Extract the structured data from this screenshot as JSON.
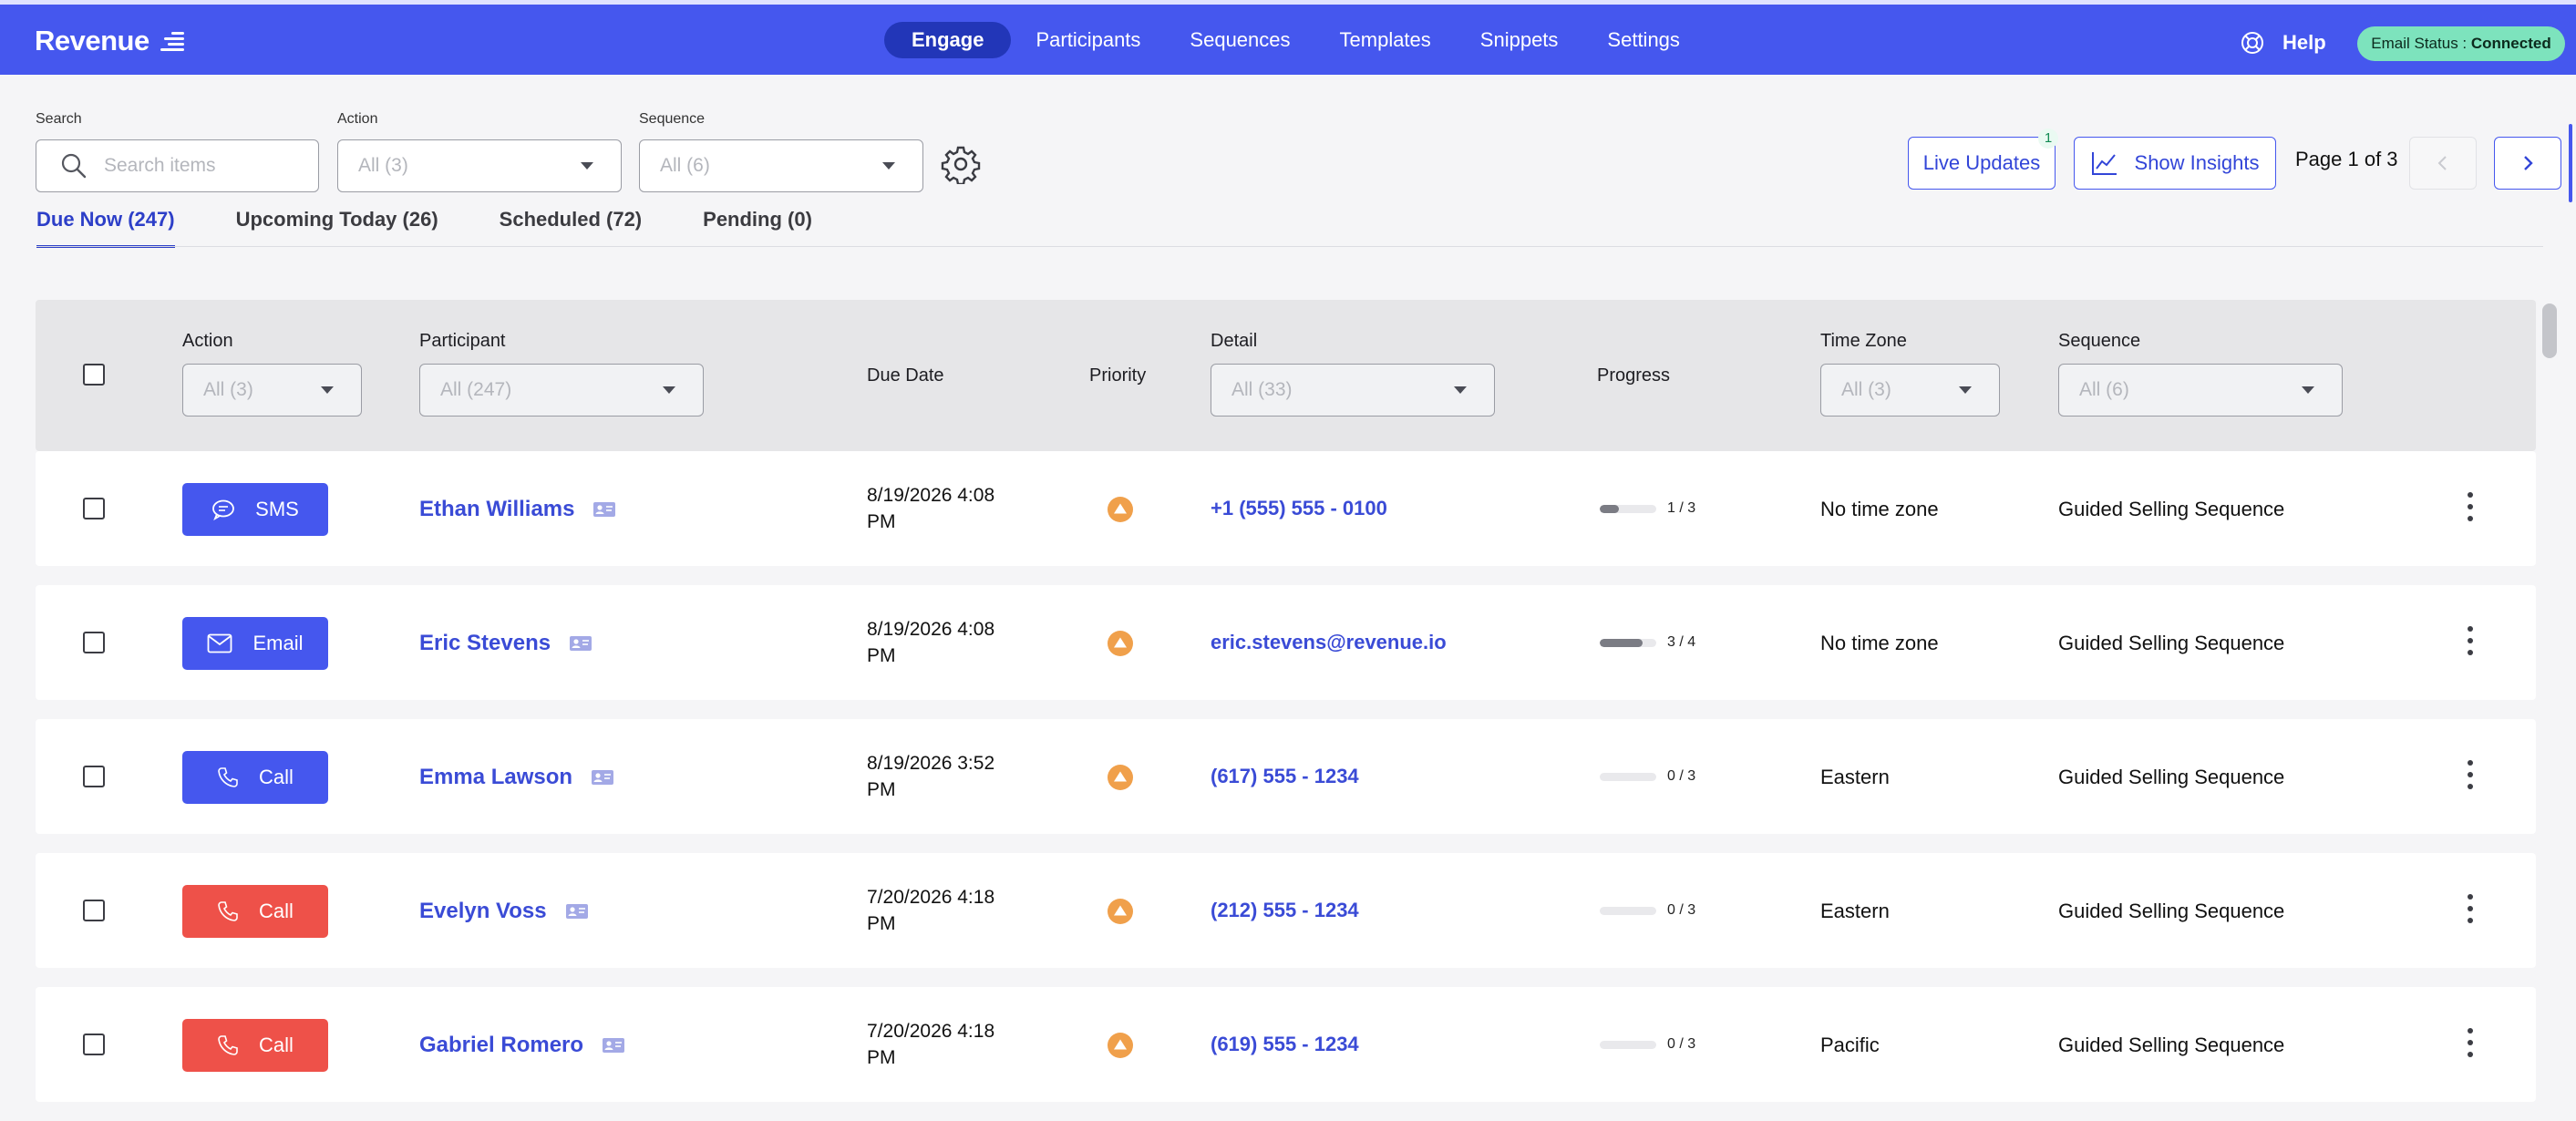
{
  "app": {
    "brand": "Revenue"
  },
  "nav": {
    "items": [
      "Engage",
      "Participants",
      "Sequences",
      "Templates",
      "Snippets",
      "Settings"
    ],
    "active": "Engage",
    "help": "Help",
    "email_status_label": "Email Status : ",
    "email_status_value": "Connected"
  },
  "filters": {
    "search_label": "Search",
    "search_placeholder": "Search items",
    "action_label": "Action",
    "action_value": "All (3)",
    "sequence_label": "Sequence",
    "sequence_value": "All (6)"
  },
  "toolbar": {
    "live_updates": "Live Updates",
    "live_updates_badge": "1",
    "show_insights": "Show Insights",
    "page_text": "Page 1 of 3"
  },
  "tabs": [
    "Due Now (247)",
    "Upcoming Today (26)",
    "Scheduled (72)",
    "Pending (0)"
  ],
  "table": {
    "headers": {
      "action": "Action",
      "participant": "Participant",
      "due_date": "Due Date",
      "priority": "Priority",
      "detail": "Detail",
      "progress": "Progress",
      "time_zone": "Time Zone",
      "sequence": "Sequence"
    },
    "header_filters": {
      "action": "All (3)",
      "participant": "All (247)",
      "detail": "All (33)",
      "time_zone": "All (3)",
      "sequence": "All (6)"
    },
    "rows": [
      {
        "action": "SMS",
        "action_type": "sms",
        "color": "#4557ee",
        "participant": "Ethan Williams",
        "due_line1": "8/19/2026 4:08",
        "due_line2": "PM",
        "detail": "+1 (555) 555 - 0100",
        "progress_done": 1,
        "progress_total": 3,
        "progress_text": "1 / 3",
        "time_zone": "No time zone",
        "sequence": "Guided Selling Sequence"
      },
      {
        "action": "Email",
        "action_type": "email",
        "color": "#4557ee",
        "participant": "Eric Stevens",
        "due_line1": "8/19/2026 4:08",
        "due_line2": "PM",
        "detail": "eric.stevens@revenue.io",
        "progress_done": 3,
        "progress_total": 4,
        "progress_text": "3 / 4",
        "time_zone": "No time zone",
        "sequence": "Guided Selling Sequence"
      },
      {
        "action": "Call",
        "action_type": "call",
        "color": "#4557ee",
        "participant": "Emma Lawson",
        "due_line1": "8/19/2026 3:52",
        "due_line2": "PM",
        "detail": "(617) 555 - 1234",
        "progress_done": 0,
        "progress_total": 3,
        "progress_text": "0 / 3",
        "time_zone": "Eastern",
        "sequence": "Guided Selling Sequence"
      },
      {
        "action": "Call",
        "action_type": "call",
        "color": "#ee5149",
        "participant": "Evelyn Voss",
        "due_line1": "7/20/2026 4:18",
        "due_line2": "PM",
        "detail": "(212) 555 - 1234",
        "progress_done": 0,
        "progress_total": 3,
        "progress_text": "0 / 3",
        "time_zone": "Eastern",
        "sequence": "Guided Selling Sequence"
      },
      {
        "action": "Call",
        "action_type": "call",
        "color": "#ee5149",
        "participant": "Gabriel Romero",
        "due_line1": "7/20/2026 4:18",
        "due_line2": "PM",
        "detail": "(619) 555 - 1234",
        "progress_done": 0,
        "progress_total": 3,
        "progress_text": "0 / 3",
        "time_zone": "Pacific",
        "sequence": "Guided Selling Sequence"
      }
    ]
  },
  "colors": {
    "primary": "#4557ee",
    "danger": "#ee5149",
    "priority": "#f0a04b",
    "status_ok": "#7de3bd"
  }
}
